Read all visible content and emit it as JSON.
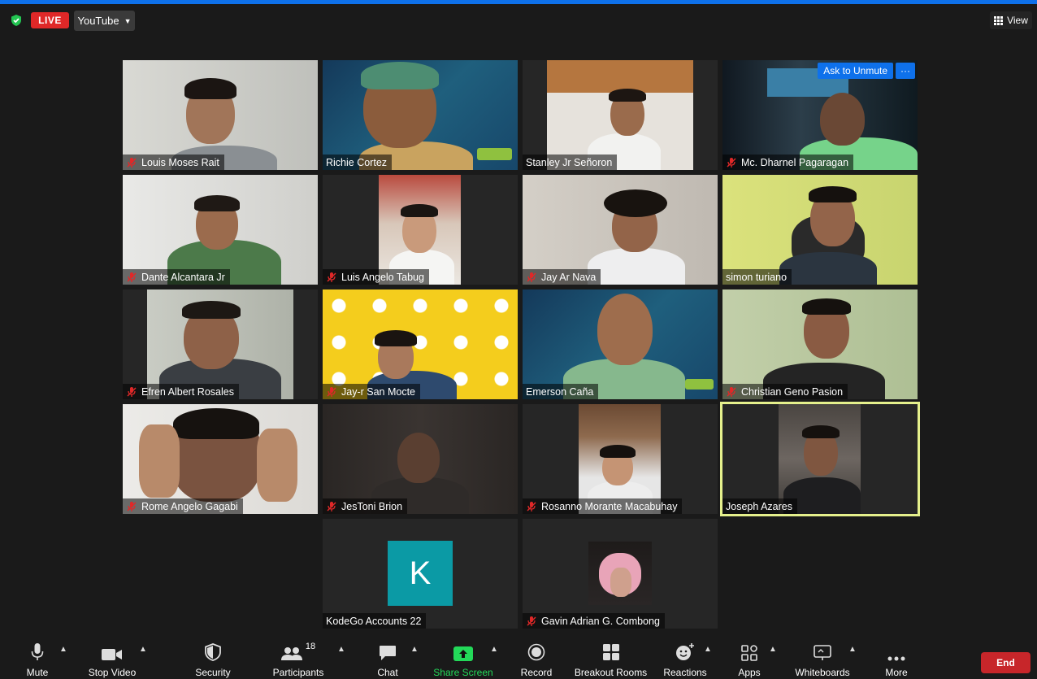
{
  "topbar": {
    "live_label": "LIVE",
    "stream_target": "YouTube",
    "view_label": "View"
  },
  "participants": [
    {
      "name": "Louis Moses Rait",
      "muted": true
    },
    {
      "name": "Richie Cortez",
      "muted": false
    },
    {
      "name": "Stanley Jr Señoron",
      "muted": false
    },
    {
      "name": "Mc. Dharnel Pagaragan",
      "muted": true,
      "ask_to_unmute": "Ask to Unmute",
      "more_label": "···"
    },
    {
      "name": "Dante Alcantara Jr",
      "muted": true
    },
    {
      "name": "Luis Angelo Tabug",
      "muted": true
    },
    {
      "name": "Jay Ar Nava",
      "muted": true
    },
    {
      "name": "simon turiano",
      "muted": false
    },
    {
      "name": "Efren Albert Rosales",
      "muted": true
    },
    {
      "name": "Jay-r San Mocte",
      "muted": true
    },
    {
      "name": "Emerson Caña",
      "muted": false
    },
    {
      "name": "Christian Geno Pasion",
      "muted": true
    },
    {
      "name": "Rome Angelo Gagabi",
      "muted": true
    },
    {
      "name": "JesToni Brion",
      "muted": true
    },
    {
      "name": "Rosanno Morante Macabuhay",
      "muted": true
    },
    {
      "name": "Joseph Azares",
      "muted": false,
      "active_speaker": true
    },
    {
      "name": "KodeGo Accounts 22",
      "muted": false,
      "avatar_letter": "K"
    },
    {
      "name": "Gavin Adrian G.  Combong",
      "muted": true
    }
  ],
  "toolbar": {
    "mute": "Mute",
    "stop_video": "Stop Video",
    "security": "Security",
    "participants": "Participants",
    "participants_count": "18",
    "chat": "Chat",
    "share_screen": "Share Screen",
    "record": "Record",
    "breakout_rooms": "Breakout Rooms",
    "reactions": "Reactions",
    "apps": "Apps",
    "whiteboards": "Whiteboards",
    "more": "More",
    "end": "End"
  },
  "colors": {
    "accent": "#0e71eb",
    "live": "#e02828",
    "share": "#23d959",
    "end": "#c7262a",
    "active_speaker": "#e5f08c"
  }
}
